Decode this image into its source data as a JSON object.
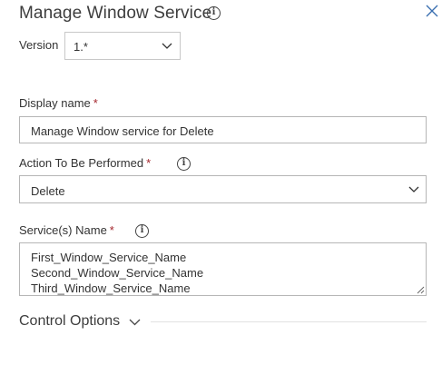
{
  "panel": {
    "title": "Manage Window Service",
    "info_icon_glyph": "i"
  },
  "version": {
    "label": "Version",
    "selected": "1.*"
  },
  "display_name": {
    "label": "Display name",
    "required_mark": "*",
    "value": "Manage Window service for Delete"
  },
  "action": {
    "label": "Action To Be Performed",
    "required_mark": "*",
    "selected": "Delete"
  },
  "services": {
    "label": "Service(s) Name",
    "required_mark": "*",
    "lines": [
      "First_Window_Service_Name",
      "Second_Window_Service_Name",
      "Third_Window_Service_Name"
    ]
  },
  "control_options": {
    "label": "Control Options"
  },
  "colors": {
    "required": "#a4262c",
    "border": "#b6b6b6",
    "text": "#333333"
  }
}
